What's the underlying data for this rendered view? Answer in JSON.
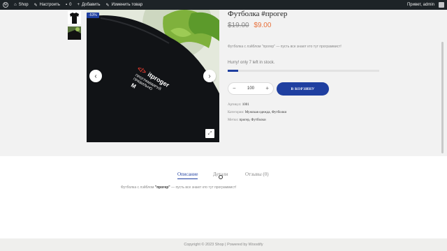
{
  "admin_bar": {
    "site_name": "Shop",
    "customize": "Настроить",
    "comments_count": "0",
    "add_new": "Добавить",
    "edit_product": "Изменить товар",
    "greeting": "Привет, admin"
  },
  "product": {
    "sale_badge": "-53%",
    "title": "Футболка #прогер",
    "price_old": "$19.00",
    "price_new": "$9.00",
    "short_description": "Футболка с лэйблом \"прогер\" — пусть все знают кто тут программист!",
    "stock_text": "Hurry! only 7 left in stock.",
    "stock_level": 0.07,
    "quantity": "100",
    "add_to_cart": "В КОРЗИНУ",
    "sku_label": "Артикул:",
    "sku": "1001",
    "categories_label": "Категории:",
    "categories": "Мужская одежда, Футболки",
    "tags_label": "Метки:",
    "tags": "прогер, Футболки"
  },
  "image": {
    "label_brand": "</> itproger",
    "label_line1": "ПРОГРАММИРУЙ",
    "label_line2": "ПРАВИЛЬНО",
    "label_size": "M"
  },
  "tabs": {
    "description": "Описание",
    "details": "Детали",
    "reviews": "Отзывы (0)"
  },
  "tab_content": {
    "prefix": "Футболка с лэйблом ",
    "bold": "\"прогер\"",
    "suffix": " — пусть все знают кто тут программист!"
  },
  "footer": {
    "text": "Copyright © 2023 Shop | Powered by Woostify"
  },
  "colors": {
    "accent": "#1f3fa0",
    "sale_price": "#e8703a",
    "admin_bar": "#1d2327"
  }
}
